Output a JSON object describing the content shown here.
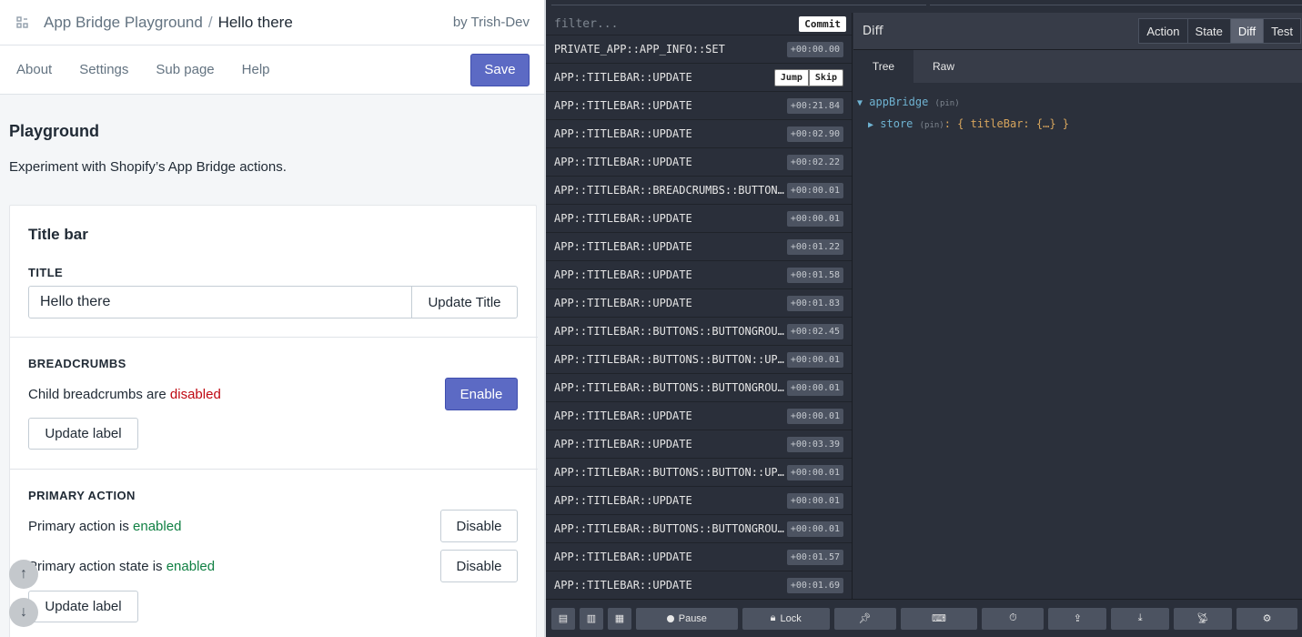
{
  "left": {
    "titlebar": {
      "app_name": "App Bridge Playground",
      "separator": "/",
      "current": "Hello there",
      "by": "by Trish-Dev"
    },
    "nav": {
      "items": [
        "About",
        "Settings",
        "Sub page",
        "Help"
      ],
      "save": "Save"
    },
    "page": {
      "title": "Playground",
      "description": "Experiment with Shopify’s App Bridge actions."
    },
    "card": {
      "title": "Title bar",
      "title_label": "TITLE",
      "title_value": "Hello there",
      "update_title": "Update Title",
      "breadcrumbs_label": "BREADCRUMBS",
      "breadcrumbs_text": "Child breadcrumbs are ",
      "breadcrumbs_state": "disabled",
      "enable": "Enable",
      "update_label_1": "Update label",
      "primary_label": "PRIMARY ACTION",
      "primary_text": "Primary action is ",
      "primary_state": "enabled",
      "disable_1": "Disable",
      "primary_state_text": "Primary action state is ",
      "primary_state_value": "enabled",
      "disable_2": "Disable",
      "update_label_2": "Update label"
    }
  },
  "devtools": {
    "filter_placeholder": "filter...",
    "commit": "Commit",
    "jump": "Jump",
    "skip": "Skip",
    "actions": [
      {
        "name": "PRIVATE_APP::APP_INFO::SET",
        "time": "+00:00.00"
      },
      {
        "name": "APP::TITLEBAR::UPDATE",
        "time": ""
      },
      {
        "name": "APP::TITLEBAR::UPDATE",
        "time": "+00:21.84"
      },
      {
        "name": "APP::TITLEBAR::UPDATE",
        "time": "+00:02.90"
      },
      {
        "name": "APP::TITLEBAR::UPDATE",
        "time": "+00:02.22"
      },
      {
        "name": "APP::TITLEBAR::BREADCRUMBS::BUTTON...",
        "time": "+00:00.01"
      },
      {
        "name": "APP::TITLEBAR::UPDATE",
        "time": "+00:00.01"
      },
      {
        "name": "APP::TITLEBAR::UPDATE",
        "time": "+00:01.22"
      },
      {
        "name": "APP::TITLEBAR::UPDATE",
        "time": "+00:01.58"
      },
      {
        "name": "APP::TITLEBAR::UPDATE",
        "time": "+00:01.83"
      },
      {
        "name": "APP::TITLEBAR::BUTTONS::BUTTONGROU...",
        "time": "+00:02.45"
      },
      {
        "name": "APP::TITLEBAR::BUTTONS::BUTTON::UP...",
        "time": "+00:00.01"
      },
      {
        "name": "APP::TITLEBAR::BUTTONS::BUTTONGROU...",
        "time": "+00:00.01"
      },
      {
        "name": "APP::TITLEBAR::UPDATE",
        "time": "+00:00.01"
      },
      {
        "name": "APP::TITLEBAR::UPDATE",
        "time": "+00:03.39"
      },
      {
        "name": "APP::TITLEBAR::BUTTONS::BUTTON::UP...",
        "time": "+00:00.01"
      },
      {
        "name": "APP::TITLEBAR::UPDATE",
        "time": "+00:00.01"
      },
      {
        "name": "APP::TITLEBAR::BUTTONS::BUTTONGROU...",
        "time": "+00:00.01"
      },
      {
        "name": "APP::TITLEBAR::UPDATE",
        "time": "+00:01.57"
      },
      {
        "name": "APP::TITLEBAR::UPDATE",
        "time": "+00:01.69"
      }
    ],
    "monitor": {
      "title": "Diff",
      "tabs": [
        "Action",
        "State",
        "Diff",
        "Test"
      ],
      "selected_tab": "Diff",
      "subtabs": [
        "Tree",
        "Raw"
      ],
      "selected_subtab": "Tree",
      "tree": {
        "root_key": "appBridge",
        "root_pin": "(pin)",
        "child_key": "store",
        "child_pin": "(pin)",
        "child_value": "{ titleBar: {…} }"
      }
    },
    "bottom": {
      "pause": "Pause",
      "lock": "Lock"
    }
  }
}
